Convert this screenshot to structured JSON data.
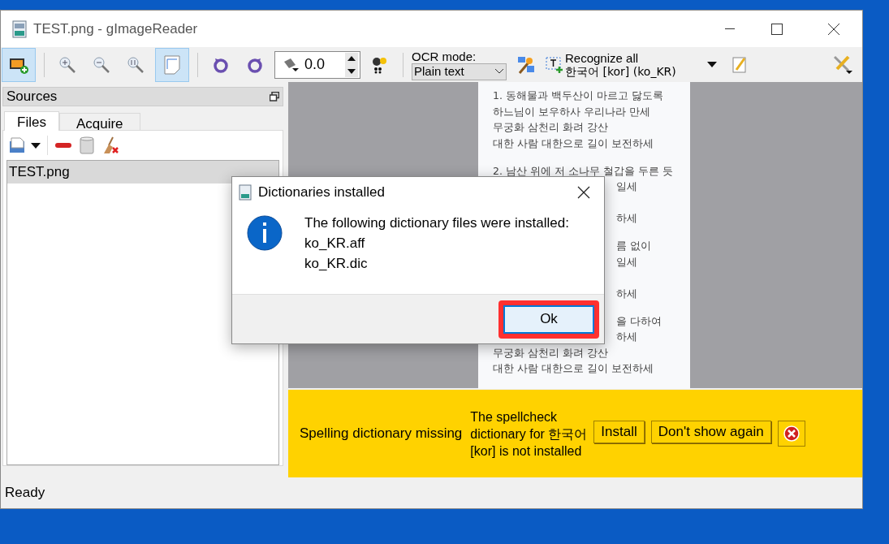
{
  "window": {
    "title": "TEST.png - gImageReader"
  },
  "toolbar": {
    "rotation_value": "0.0",
    "ocr_mode_label": "OCR mode:",
    "ocr_mode_value": "Plain text",
    "recognize_label": "Recognize all",
    "language": "한국어 [kor] (ko_KR)"
  },
  "sources": {
    "title": "Sources",
    "tabs": [
      {
        "label": "Files",
        "selected": true
      },
      {
        "label": "Acquire",
        "selected": false
      }
    ],
    "files": [
      {
        "name": "TEST.png",
        "selected": true
      }
    ]
  },
  "document": {
    "stanzas": [
      {
        "lines": [
          {
            "kind": "full",
            "text": "1. 동해물과 백두산이 마르고 닳도록"
          },
          {
            "kind": "full",
            "text": "하느님이 보우하사 우리나라 만세"
          },
          {
            "kind": "full",
            "text": "무궁화 삼천리 화려 강산"
          },
          {
            "kind": "full",
            "text": "대한 사람 대한으로 길이 보전하세"
          }
        ]
      },
      {
        "lines": [
          {
            "kind": "full",
            "text": "2. 남산 위에 저 소나무 철갑을 두른 듯"
          },
          {
            "kind": "fragment",
            "text": "일세"
          },
          {
            "kind": "fragment",
            "text": "하세"
          }
        ]
      },
      {
        "lines": [
          {
            "kind": "fragment",
            "text": "름 없이"
          },
          {
            "kind": "fragment",
            "text": "일세"
          },
          {
            "kind": "fragment",
            "text": "하세"
          }
        ]
      },
      {
        "lines": [
          {
            "kind": "fragment",
            "text": "을 다하여"
          },
          {
            "kind": "fragment",
            "text": "하세"
          },
          {
            "kind": "full",
            "text": "무궁화 삼천리 화려 강산"
          },
          {
            "kind": "full",
            "text": "대한 사람 대한으로 길이 보전하세"
          }
        ]
      }
    ]
  },
  "spell_bar": {
    "title": "Spelling dictionary missing",
    "message": "The spellcheck dictionary for 한국어 [kor] is not installed",
    "buttons": [
      "Install",
      "Don't show again"
    ]
  },
  "status_bar": {
    "text": "Ready"
  },
  "dialog": {
    "title": "Dictionaries installed",
    "message": "The following dictionary files were installed:",
    "files": [
      "ko_KR.aff",
      "ko_KR.dic"
    ],
    "button": "Ok",
    "highlighted": true
  }
}
